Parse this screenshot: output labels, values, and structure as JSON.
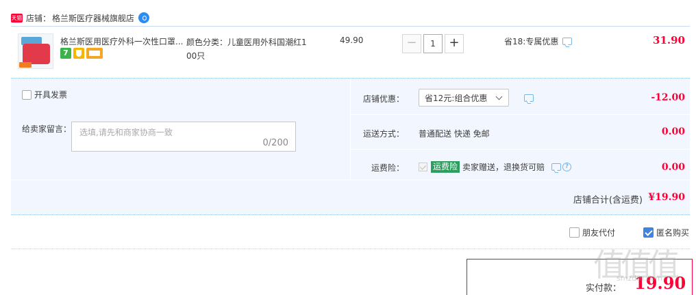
{
  "shop": {
    "badge": "天猫",
    "label": "店铺：",
    "name": "格兰斯医疗器械旗舰店"
  },
  "item": {
    "title": "格兰斯医用医疗外科一次性口罩...",
    "service_icons": [
      "7",
      "shield-icon",
      "card-icon"
    ],
    "attr_line1": "颜色分类：儿童医用外科国潮红1",
    "attr_line2": "00只",
    "price": "49.90",
    "quantity": "1",
    "minus": "−",
    "plus": "+",
    "promo": "省18:专属优惠",
    "subtotal": "31.90"
  },
  "invoice": {
    "label": "开具发票"
  },
  "memo": {
    "label": "给卖家留言：",
    "placeholder": "选填,请先和商家协商一致",
    "count": "0/200"
  },
  "shop_discount": {
    "label": "店铺优惠：",
    "selected": "省12元:组合优惠",
    "amount": "-12.00"
  },
  "shipping": {
    "label": "运送方式：",
    "value": "普通配送 快递 免邮",
    "amount": "0.00"
  },
  "insurance": {
    "label": "运费险：",
    "badge": "运费险",
    "text": "卖家赠送，退换货可赔",
    "help": "?",
    "amount": "0.00"
  },
  "shop_total": {
    "label": "店铺合计(含运费)",
    "amount": "¥19.90"
  },
  "options": {
    "friend_pay": "朋友代付",
    "anonymous": "匿名购买",
    "anonymous_checked": true
  },
  "payment": {
    "label": "实付款：",
    "amount": "19.90"
  },
  "watermark": {
    "main": "值值值",
    "sub": "smzdm.com"
  },
  "colors": {
    "accent_red": "#ff0036",
    "panel_bg": "#f2f7ff",
    "checkbox_blue": "#3d85e0",
    "insurance_green": "#2c9f5f"
  }
}
